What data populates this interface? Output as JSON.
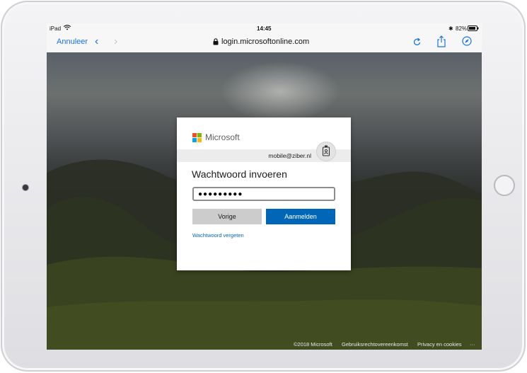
{
  "status_bar": {
    "device": "iPad",
    "time": "14:45",
    "battery": "82%"
  },
  "browser": {
    "cancel_label": "Annuleer",
    "url": "login.microsoftonline.com"
  },
  "login": {
    "brand": "Microsoft",
    "email": "mobile@ziber.nl",
    "heading": "Wachtwoord invoeren",
    "password_masked": "●●●●●●●●●",
    "back_label": "Vorige",
    "signin_label": "Aanmelden",
    "forgot_label": "Wachtwoord vergeten"
  },
  "footer": {
    "copyright": "©2018 Microsoft",
    "terms": "Gebruiksrechtovereenkomst",
    "privacy": "Privacy en cookies",
    "more": "···"
  },
  "colors": {
    "accent": "#0067b8",
    "ios_blue": "#1a73e8"
  }
}
